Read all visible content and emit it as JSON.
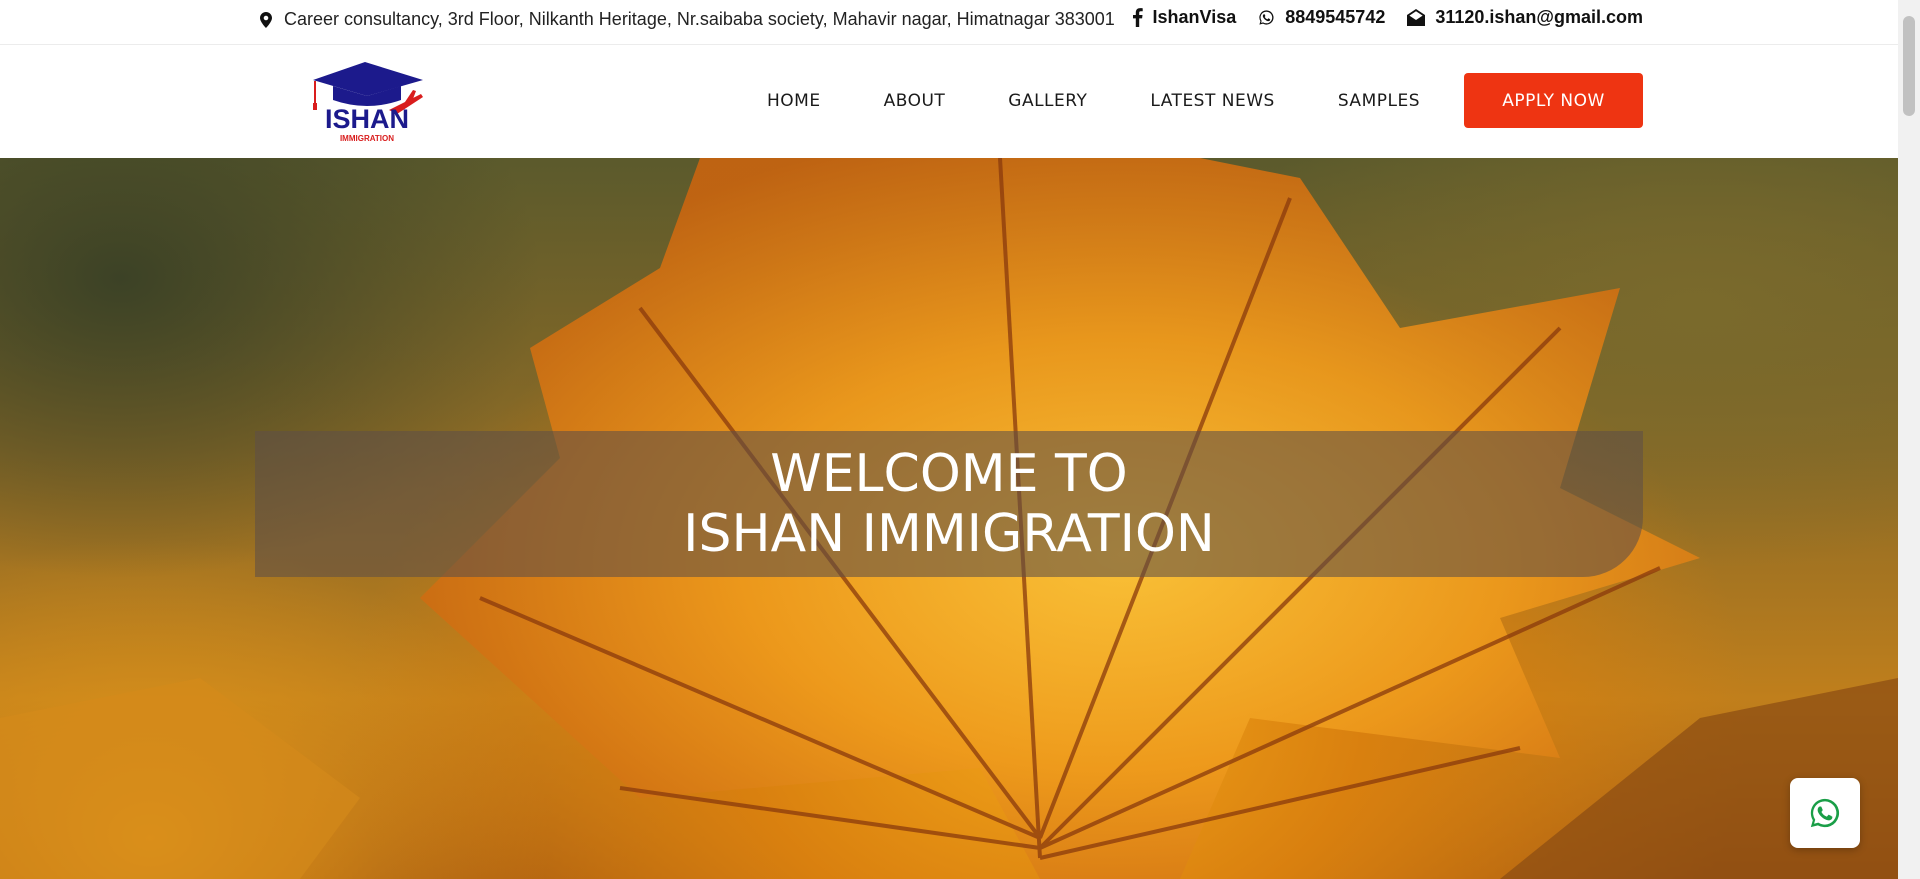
{
  "topbar": {
    "address": "Career consultancy, 3rd Floor, Nilkanth Heritage, Nr.saibaba society, Mahavir nagar, Himatnagar 383001",
    "facebook": "IshanVisa",
    "phone": "8849545742",
    "email": "31120.ishan@gmail.com",
    "icons": [
      "map-marker-icon",
      "facebook-icon",
      "whatsapp-icon",
      "envelope-icon"
    ]
  },
  "logo": {
    "name": "ISHAN",
    "tagline": "IMMIGRATION"
  },
  "nav": {
    "items": [
      {
        "label": "HOME"
      },
      {
        "label": "ABOUT"
      },
      {
        "label": "GALLERY"
      },
      {
        "label": "LATEST NEWS"
      },
      {
        "label": "SAMPLES"
      }
    ],
    "apply_label": "APPLY NOW"
  },
  "hero": {
    "line1": "WELCOME TO",
    "line2": "ISHAN IMMIGRATION"
  },
  "colors": {
    "accent": "#ee3412",
    "logo_blue": "#1c1a8c",
    "whatsapp_green": "#1a9e47"
  }
}
